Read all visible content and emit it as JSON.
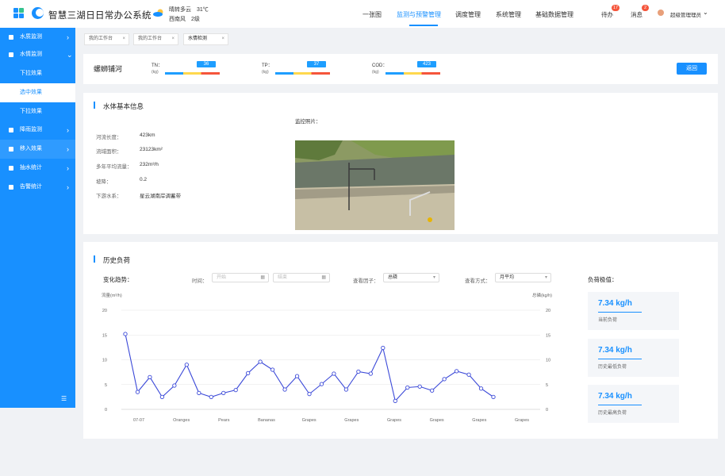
{
  "header": {
    "app_title": "智慧三湖日日常办公系统",
    "weather_line1": "晴转多云　31℃",
    "weather_line2": "西南风　2级",
    "nav": [
      "一张图",
      "监测与预警管理",
      "调度管理",
      "系统管理",
      "基础数据管理"
    ],
    "active_nav": "监测与预警管理",
    "todo_label": "待办",
    "todo_count": "17",
    "message_label": "消息",
    "message_count": "2",
    "user_label": "超级管理理员"
  },
  "sidebar": {
    "items": [
      {
        "label": "水质监测"
      },
      {
        "label": "水情监测"
      },
      {
        "label": "降雨监测"
      },
      {
        "label": "移入效果"
      },
      {
        "label": "抽水统计"
      },
      {
        "label": "告警统计"
      }
    ],
    "subitems": [
      "下拉效果",
      "选中效果",
      "下拉效果"
    ]
  },
  "tabs": [
    {
      "label": "我的工作台"
    },
    {
      "label": "我的工作台"
    },
    {
      "label": "水情检测"
    }
  ],
  "river": {
    "name": "螺蛳铺河",
    "indicators": [
      {
        "name": "TN：",
        "value": "36",
        "unit": "(kg)"
      },
      {
        "name": "TP：",
        "value": "37",
        "unit": "(kg)"
      },
      {
        "name": "COD：",
        "value": "423",
        "unit": "(kg)"
      }
    ],
    "back_label": "返回"
  },
  "basic_info": {
    "title": "水体基本信息",
    "fields": [
      {
        "label": "河流长度：",
        "value": "423km"
      },
      {
        "label": "流域面积：",
        "value": "23123km²"
      },
      {
        "label": "多年平均流量：",
        "value": "232m³/h"
      },
      {
        "label": "坡降：",
        "value": "0.2"
      },
      {
        "label": "下游水系：",
        "value": "星云湖南岸调蓄带"
      }
    ],
    "photo_label": "监控照片："
  },
  "history": {
    "title": "历史负荷",
    "trend_label": "变化趋势：",
    "time_label": "时间：",
    "start_placeholder": "开始",
    "end_placeholder": "结束",
    "factor_label": "查看因子：",
    "factor_value": "总磷",
    "mode_label": "查看方式：",
    "mode_value": "月平均",
    "extreme_title": "负荷极值：",
    "kpis": [
      {
        "value": "7.34 kg/h",
        "label": "当前负荷"
      },
      {
        "value": "7.34 kg/h",
        "label": "历史最低负荷"
      },
      {
        "value": "7.34 kg/h",
        "label": "历史最高负荷"
      }
    ]
  },
  "colors": {
    "accent": "#1890ff",
    "line": "#3b49d8",
    "bar_mid": "#ffd84d",
    "bar_end": "#f5553b"
  },
  "chart_data": {
    "type": "line",
    "ylabel_left": "流量(m³/h)",
    "ylabel_right": "总磷(kg/h)",
    "ylim": [
      0,
      20
    ],
    "yticks": [
      0,
      5,
      10,
      15,
      20
    ],
    "grid": true,
    "x_tick_labels": [
      "07-07",
      "Oranges",
      "Pears",
      "Bananas",
      "Grapes",
      "Grapes",
      "Grapes",
      "Grapes",
      "Grapes",
      "Grapes"
    ],
    "series": [
      {
        "values": [
          15.2,
          3.5,
          6.5,
          2.5,
          4.8,
          9.0,
          3.3,
          2.5,
          3.3,
          3.9,
          7.3,
          9.6,
          8.0,
          4.0,
          6.7,
          3.1,
          5.1,
          7.2,
          4.0,
          7.6,
          7.2,
          12.4,
          1.7,
          4.4,
          4.6,
          3.8,
          6.1,
          7.7,
          7.0,
          4.2,
          2.5
        ]
      }
    ]
  }
}
